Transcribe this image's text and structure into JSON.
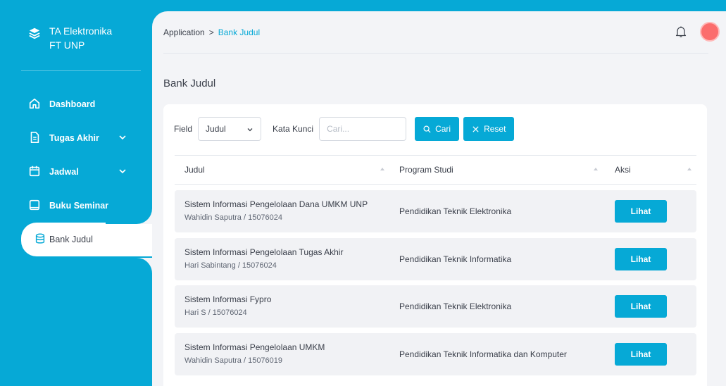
{
  "colors": {
    "accent": "#06a9d6",
    "avatar": "#fb6d6d",
    "row_bg": "#f1f2f5"
  },
  "brand": {
    "line1": "TA Elektronika",
    "line2": "FT UNP",
    "icon": "layers-icon"
  },
  "sidebar": {
    "items": [
      {
        "label": "Dashboard",
        "icon": "home-icon"
      },
      {
        "label": "Tugas Akhir",
        "icon": "document-icon",
        "has_submenu": true
      },
      {
        "label": "Jadwal",
        "icon": "calendar-icon",
        "has_submenu": true
      },
      {
        "label": "Buku Seminar",
        "icon": "book-icon"
      },
      {
        "label": "Bank Judul",
        "icon": "database-icon",
        "active": true
      }
    ]
  },
  "header": {
    "breadcrumb": {
      "root": "Application",
      "separator": ">",
      "current": "Bank Judul"
    },
    "notification_icon": "bell-icon"
  },
  "page": {
    "title": "Bank Judul"
  },
  "filter": {
    "field_label": "Field",
    "field_value": "Judul",
    "keyword_label": "Kata Kunci",
    "keyword_placeholder": "Cari...",
    "search_label": "Cari",
    "reset_label": "Reset"
  },
  "table": {
    "columns": [
      "Judul",
      "Program Studi",
      "Aksi"
    ],
    "action_label": "Lihat",
    "rows": [
      {
        "title": "Sistem Informasi Pengelolaan Dana UMKM UNP",
        "author": "Wahidin Saputra / 15076024",
        "prodi": "Pendidikan Teknik Elektronika"
      },
      {
        "title": "Sistem Informasi Pengelolaan Tugas Akhir",
        "author": "Hari Sabintang / 15076024",
        "prodi": "Pendidikan Teknik Informatika"
      },
      {
        "title": "Sistem Informasi Fypro",
        "author": "Hari S / 15076024",
        "prodi": "Pendidikan Teknik Elektronika"
      },
      {
        "title": "Sistem Informasi Pengelolaan UMKM",
        "author": "Wahidin Saputra / 15076019",
        "prodi": "Pendidikan Teknik Informatika dan Komputer"
      }
    ]
  }
}
